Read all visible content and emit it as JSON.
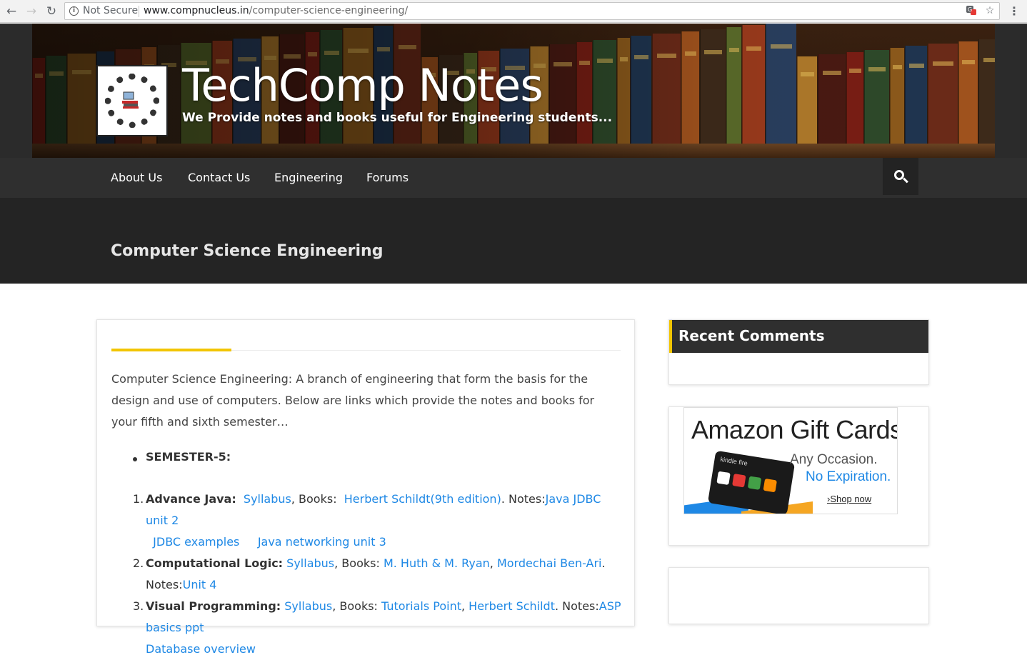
{
  "browser": {
    "security_label": "Not Secure",
    "url_host": "www.compnucleus.in",
    "url_path": "/computer-science-engineering/",
    "menu_glyph": "⋮"
  },
  "site": {
    "title": "TechComp Notes",
    "tagline": "We Provide notes and books useful for Engineering students..."
  },
  "nav": {
    "items": [
      "About Us",
      "Contact Us",
      "Engineering",
      "Forums"
    ]
  },
  "page": {
    "title": "Computer Science Engineering"
  },
  "article": {
    "intro": "Computer Science Engineering: A branch of engineering that form the basis for the design and use of computers. Below are links which provide the notes and books for your fifth and sixth semester…",
    "semester_label": "SEMESTER-5:",
    "courses": [
      {
        "num": "1.",
        "name": "Advance Java:",
        "syllabus": "Syllabus",
        "books_label": "Books:",
        "books": [
          "Herbert Schildt(9th edition)"
        ],
        "notes_label": "Notes:",
        "notes": [
          "Java JDBC unit 2",
          "JDBC examples",
          "Java networking unit 3"
        ]
      },
      {
        "num": "2.",
        "name": "Computational Logic:",
        "syllabus": "Syllabus",
        "books_label": "Books:",
        "books": [
          "M. Huth & M. Ryan",
          "Mordechai Ben-Ari"
        ],
        "notes_label": "Notes:",
        "notes": [
          "Unit 4"
        ]
      },
      {
        "num": "3.",
        "name": "Visual Programming:",
        "syllabus": "Syllabus",
        "books_label": "Books:",
        "books": [
          "Tutorials Point",
          "Herbert Schildt"
        ],
        "notes_label": "Notes:",
        "notes": [
          "ASP basics ppt",
          "Database overview"
        ]
      }
    ]
  },
  "sidebar": {
    "recent_comments_title": "Recent Comments",
    "ad": {
      "title": "Amazon Gift Cards",
      "line1": "Any Occasion.",
      "line2": "No Expiration.",
      "shop": "Shop now",
      "card_brand": "kindle fire"
    }
  },
  "colors": {
    "accent": "#f2c500",
    "link": "#1e88e5",
    "nav_bg": "#2f2f2f",
    "title_band_bg": "#242424"
  },
  "icons": [
    "back-arrow-icon",
    "forward-arrow-icon",
    "reload-icon",
    "info-icon",
    "translate-icon",
    "bookmark-star-icon",
    "menu-dots-icon",
    "search-icon",
    "site-logo"
  ]
}
